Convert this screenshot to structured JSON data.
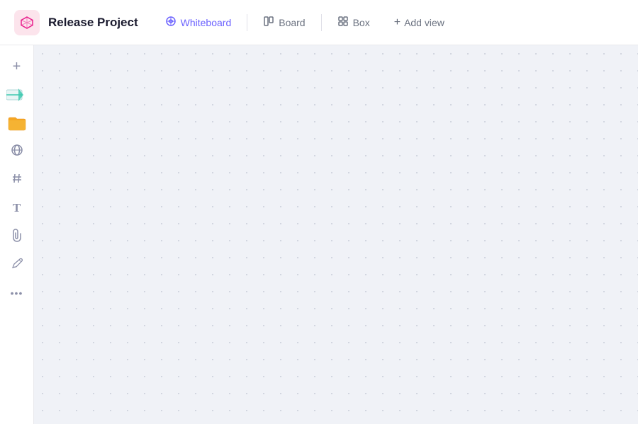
{
  "header": {
    "project_icon_color": "#e91e8c",
    "project_title": "Release Project",
    "tabs": [
      {
        "id": "whiteboard",
        "label": "Whiteboard",
        "active": true,
        "icon": "whiteboard"
      },
      {
        "id": "board",
        "label": "Board",
        "active": false,
        "icon": "board"
      },
      {
        "id": "box",
        "label": "Box",
        "active": false,
        "icon": "box"
      }
    ],
    "add_view_label": "Add view"
  },
  "sidebar": {
    "items": [
      {
        "id": "add",
        "icon": "plus",
        "label": "Add"
      },
      {
        "id": "media",
        "icon": "media",
        "label": "Media"
      },
      {
        "id": "file",
        "icon": "file",
        "label": "File"
      },
      {
        "id": "globe",
        "icon": "globe",
        "label": "Globe"
      },
      {
        "id": "hash",
        "icon": "hash",
        "label": "Hash"
      },
      {
        "id": "text",
        "icon": "text",
        "label": "Text"
      },
      {
        "id": "attach",
        "icon": "attach",
        "label": "Attach"
      },
      {
        "id": "draw",
        "icon": "draw",
        "label": "Draw"
      },
      {
        "id": "more",
        "icon": "more",
        "label": "More"
      }
    ]
  },
  "canvas": {
    "background_color": "#f0f2f7",
    "dot_color": "#c8ccd8",
    "dot_spacing": 24
  }
}
